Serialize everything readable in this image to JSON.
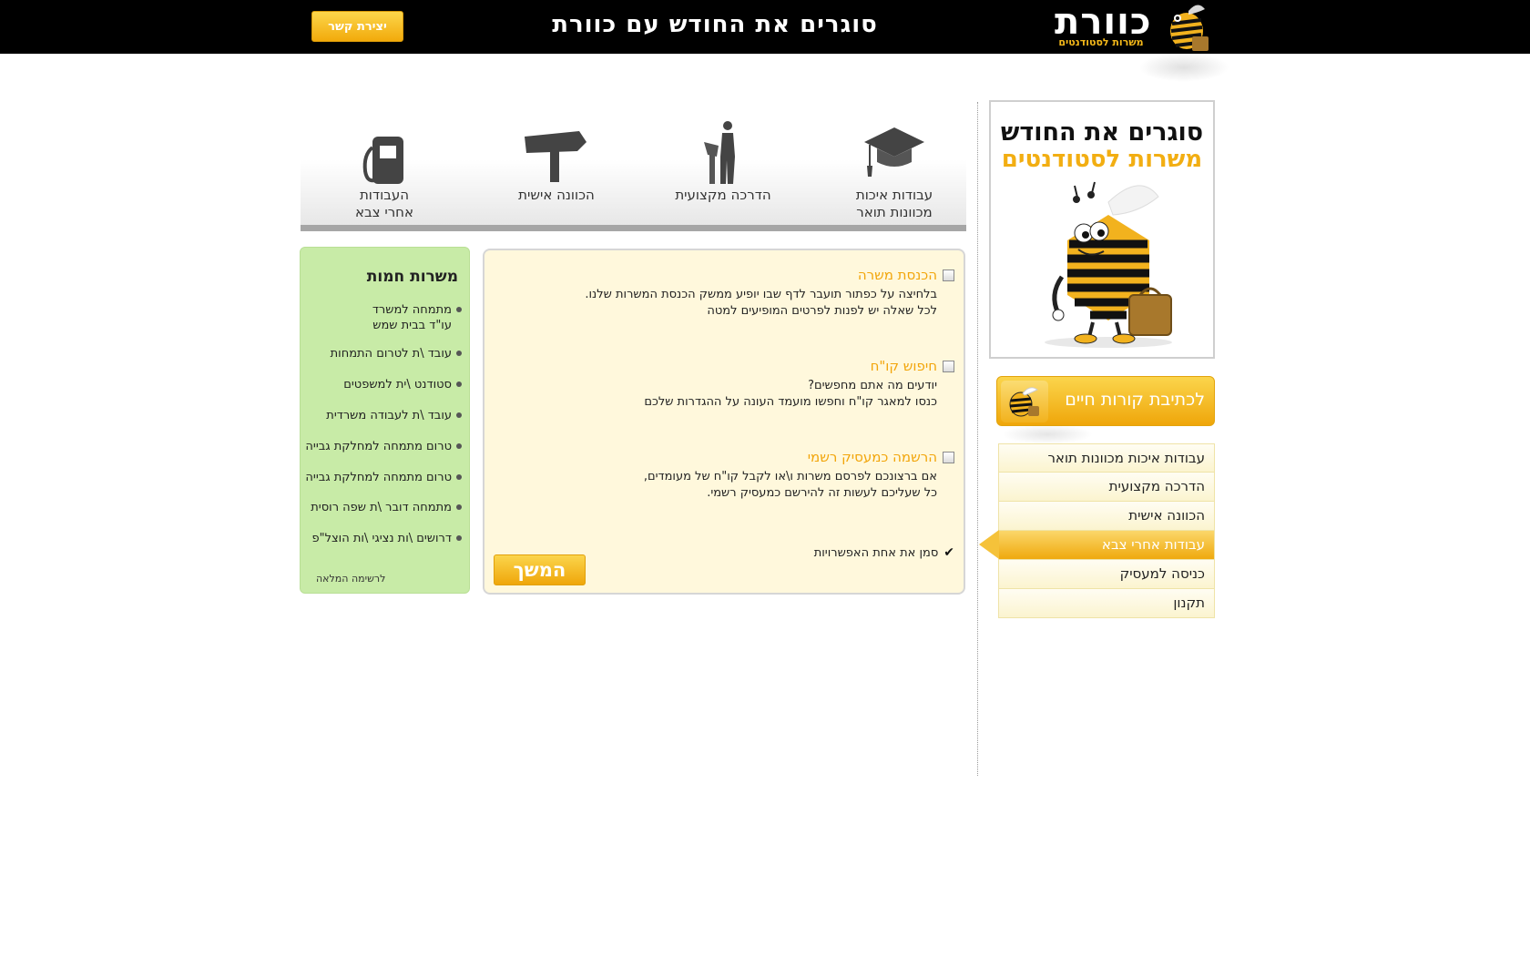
{
  "header": {
    "logo_text": "כוורת",
    "logo_sub": "משרות לסטודנטים",
    "title": "סוגרים את החודש עם כוורת",
    "contact_label": "יצירת קשר"
  },
  "promo": {
    "line1": "סוגרים את החודש",
    "line2": "משרות לסטודנטים"
  },
  "cv_button": {
    "label": "לכתיבת קורות חיים"
  },
  "sidenav": {
    "items": [
      {
        "label": "עבודות איכות מכוונות תואר",
        "active": false
      },
      {
        "label": "הדרכה מקצועית",
        "active": false
      },
      {
        "label": "הכוונה אישית",
        "active": false
      },
      {
        "label": "עבודות אחרי צבא",
        "active": true
      },
      {
        "label": "כניסה למעסיק",
        "active": false
      },
      {
        "label": "תקנון",
        "active": false
      }
    ]
  },
  "categories": [
    {
      "line1": "עבודות איכות",
      "line2": "מכוונות תואר",
      "icon": "graduation-cap-icon"
    },
    {
      "line1": "הדרכה מקצועית",
      "line2": "",
      "icon": "lecturer-icon"
    },
    {
      "line1": "הכוונה אישית",
      "line2": "",
      "icon": "signpost-icon"
    },
    {
      "line1": "העבודות",
      "line2": "אחרי צבא",
      "icon": "fuel-pump-icon"
    }
  ],
  "options": [
    {
      "title": "הכנסת משרה",
      "body1": "בלחיצה על כפתור תועבר לדף שבו יופיע ממשק הכנסת המשרות שלנו.",
      "body2": "לכל שאלה יש לפנות לפרטים המופיעים למטה"
    },
    {
      "title": "חיפוש קו\"ח",
      "body1": "יודעים מה אתם מחפשים?",
      "body2": "כנסו למאגר קו\"ח וחפשו מועמד העונה על ההגדרות שלכם"
    },
    {
      "title": "הרשמה כמעסיק רשמי",
      "body1": "אם ברצונכם לפרסם משרות ו\\או לקבל קו\"ח של מעומדים,",
      "body2": "כל שעליכם לעשות זה להירשם כמעסיק רשמי."
    }
  ],
  "mark_note": "סמן את אחת האפשרויות",
  "continue_label": "המשך",
  "hot_jobs": {
    "title": "משרות חמות",
    "items": [
      "מתמחה למשרד עו\"ד בבית שמש",
      "עובד \\ת לטרום התמחות",
      "סטודנט \\ית למשפטים",
      "עובד \\ת לעבודה משרדית",
      "טרום מתמחה למחלקת גבייה",
      "טרום מתמחה למחלקת גבייה",
      "מתמחה דובר \\ת שפה רוסית",
      "דרושים \\ות נציגי \\ות הוצל\"פ"
    ],
    "more_label": "לרשימה המלאה"
  },
  "colors": {
    "accent": "#f2a50a",
    "header_bg": "#000000",
    "hot_bg": "#c8eba7",
    "panel_bg": "#fff8dc"
  }
}
